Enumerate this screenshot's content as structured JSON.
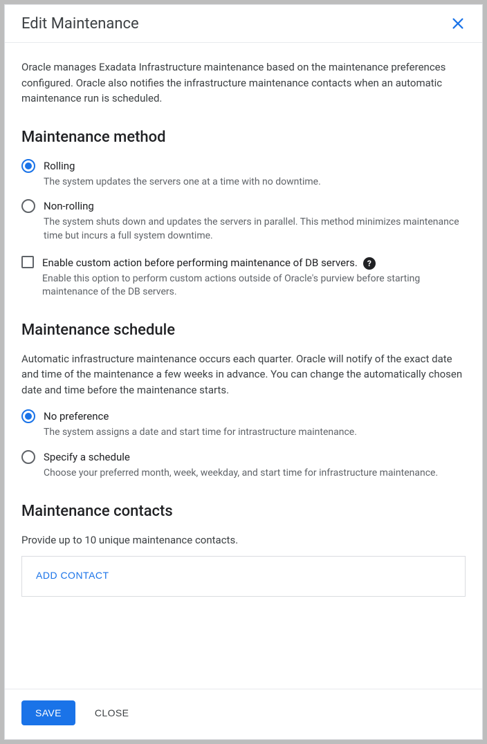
{
  "dialog": {
    "title": "Edit Maintenance",
    "intro": "Oracle manages Exadata Infrastructure maintenance based on the maintenance preferences configured. Oracle also notifies the infrastructure maintenance contacts when an automatic maintenance run is scheduled."
  },
  "method": {
    "heading": "Maintenance method",
    "options": [
      {
        "label": "Rolling",
        "desc": "The system updates the servers one at a time with no downtime.",
        "selected": true
      },
      {
        "label": "Non-rolling",
        "desc": "The system shuts down and updates the servers in parallel. This method minimizes maintenance time but incurs a full system downtime.",
        "selected": false
      }
    ],
    "custom_action": {
      "label": "Enable custom action before performing maintenance of DB servers.",
      "desc": "Enable this option to perform custom actions outside of Oracle's purview before starting maintenance of the DB servers.",
      "checked": false
    }
  },
  "schedule": {
    "heading": "Maintenance schedule",
    "desc": "Automatic infrastructure maintenance occurs each quarter. Oracle will notify of the exact date and time of the maintenance a few weeks in advance. You can change the automatically chosen date and time before the maintenance starts.",
    "options": [
      {
        "label": "No preference",
        "desc": "The system assigns a date and start time for intrastructure maintenance.",
        "selected": true
      },
      {
        "label": "Specify a schedule",
        "desc": "Choose your preferred month, week, weekday, and start time for infrastructure maintenance.",
        "selected": false
      }
    ]
  },
  "contacts": {
    "heading": "Maintenance contacts",
    "desc": "Provide up to 10 unique maintenance contacts.",
    "add_label": "ADD CONTACT"
  },
  "footer": {
    "save": "SAVE",
    "close": "CLOSE"
  }
}
